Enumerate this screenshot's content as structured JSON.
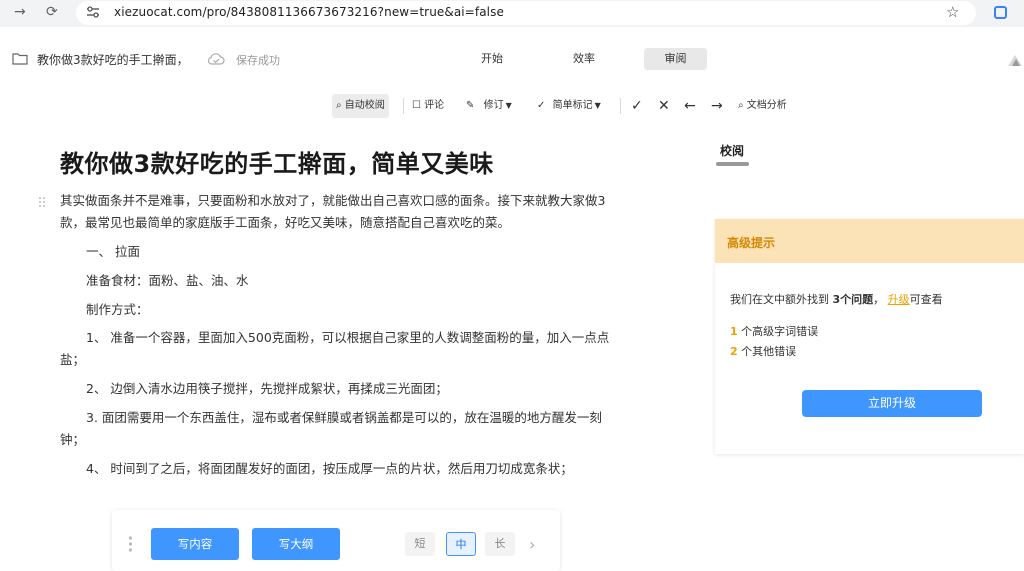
{
  "browser": {
    "url": "xiezuocat.com/pro/8438081136673673216?new=true&ai=false",
    "icons": [
      "forward-icon",
      "reload-icon",
      "site-settings-icon",
      "star-icon",
      "extension-icon"
    ]
  },
  "header": {
    "doc_title": "教你做3款好吃的手工擀面，",
    "save_status": "保存成功",
    "tabs": [
      {
        "label": "开始",
        "active": false
      },
      {
        "label": "效率",
        "active": false
      },
      {
        "label": "审阅",
        "active": true
      }
    ]
  },
  "toolbar": {
    "items": [
      {
        "label": "自动校阅",
        "icon": "search-doc-icon"
      },
      {
        "label": "评论",
        "icon": "comment-icon"
      },
      {
        "label": "修订",
        "icon": "edit-icon"
      },
      {
        "label": "简单标记",
        "icon": "markup-icon"
      },
      {
        "label": "文档分析",
        "icon": "search-icon"
      }
    ]
  },
  "article": {
    "title": "教你做3款好吃的手工擀面，简单又美味",
    "paragraphs": [
      "其实做面条并不是难事，只要面粉和水放对了，就能做出自己喜欢口感的面条。接下来就教大家做3款，最常见也最简单的家庭版手工面条，好吃又美味，随意搭配自己喜欢吃的菜。",
      "一、 拉面",
      "准备食材：面粉、盐、油、水",
      "制作方式：",
      "1、 准备一个容器，里面加入500克面粉，可以根据自己家里的人数调整面粉的量，加入一点点盐；",
      "2、 边倒入清水边用筷子搅拌，先搅拌成絮状，再揉成三光面团；",
      "3. 面团需要用一个东西盖住，湿布或者保鲜膜或者锅盖都是可以的，放在温暖的地方醒发一刻钟；",
      "4、 时间到了之后，将面团醒发好的面团，按压成厚一点的片状，然后用刀切成宽条状；"
    ]
  },
  "panel": {
    "tab": "校阅",
    "card": {
      "heading": "高级提示",
      "line1_pre": "我们在文中额外找到",
      "line1_bold": "3个问题",
      "line1_sep": "，",
      "line1_link": "升级",
      "line1_post": "可查看",
      "issues": [
        {
          "count": "1",
          "text": "个高级字词错误"
        },
        {
          "count": "2",
          "text": "个其他错误"
        }
      ],
      "button": "立即升级"
    }
  },
  "ai_bar": {
    "write_content": "写内容",
    "write_outline": "写大纲",
    "lengths": [
      {
        "label": "短",
        "active": false
      },
      {
        "label": "中",
        "active": true
      },
      {
        "label": "长",
        "active": false
      }
    ]
  },
  "colors": {
    "accent": "#4096ff",
    "warning": "#f0a000",
    "warning_bg": "#fbe3b7"
  }
}
